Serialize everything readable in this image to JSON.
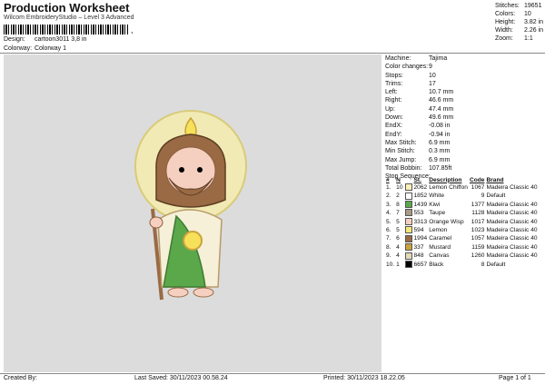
{
  "header": {
    "title": "Production Worksheet",
    "subtitle": "Wilcom EmbroideryStudio – Level 3 Advanced",
    "barcode_mark": ","
  },
  "design": {
    "design_label": "Design:",
    "design_value": "cartoon3011 3,8 in",
    "colorway_label": "Colorway:",
    "colorway_value": "Colorway 1"
  },
  "stats": [
    {
      "label": "Stitches:",
      "value": "19651"
    },
    {
      "label": "Colors:",
      "value": "10"
    },
    {
      "label": "Height:",
      "value": "3.82 in"
    },
    {
      "label": "Width:",
      "value": "2.26 in"
    },
    {
      "label": "Zoom:",
      "value": "1:1"
    }
  ],
  "machine": [
    {
      "label": "Machine:",
      "value": "Tajima"
    },
    {
      "label": "Color changes:",
      "value": "9"
    },
    {
      "label": "Stops:",
      "value": "10"
    },
    {
      "label": "Trims:",
      "value": "17"
    },
    {
      "label": "Left:",
      "value": "10.7 mm"
    },
    {
      "label": "Right:",
      "value": "46.6 mm"
    },
    {
      "label": "Up:",
      "value": "47.4 mm"
    },
    {
      "label": "Down:",
      "value": "49.6 mm"
    },
    {
      "label": "EndX:",
      "value": "-0.08 in"
    },
    {
      "label": "EndY:",
      "value": "-0.94 in"
    },
    {
      "label": "Max Stitch:",
      "value": "6.9 mm"
    },
    {
      "label": "Min Stitch:",
      "value": "0.3 mm"
    },
    {
      "label": "Max Jump:",
      "value": "6.9 mm"
    },
    {
      "label": "Total Bobbin:",
      "value": "107.85ft"
    }
  ],
  "sequence": {
    "title": "Stop Sequence:",
    "headers": [
      "#",
      "N",
      "St.",
      "Description",
      "Code",
      "Brand"
    ],
    "rows": [
      {
        "num": "1.",
        "n": "10",
        "color": "#fbf1b8",
        "st": "2062",
        "desc": "Lemon Chiffon",
        "code": "1067",
        "brand": "Madeira Classic 40"
      },
      {
        "num": "2.",
        "n": "2",
        "color": "#ffffff",
        "st": "1852",
        "desc": "White",
        "code": "9",
        "brand": "Default"
      },
      {
        "num": "3.",
        "n": "8",
        "color": "#5aa84a",
        "st": "1439",
        "desc": "Kiwi",
        "code": "1377",
        "brand": "Madeira Classic 40"
      },
      {
        "num": "4.",
        "n": "7",
        "color": "#a89a86",
        "st": "553",
        "desc": "Taupe",
        "code": "1128",
        "brand": "Madeira Classic 40"
      },
      {
        "num": "5.",
        "n": "5",
        "color": "#f5cfc0",
        "st": "3313",
        "desc": "Orange Wisp",
        "code": "1017",
        "brand": "Madeira Classic 40"
      },
      {
        "num": "6.",
        "n": "5",
        "color": "#f7e77a",
        "st": "594",
        "desc": "Lemon",
        "code": "1023",
        "brand": "Madeira Classic 40"
      },
      {
        "num": "7.",
        "n": "6",
        "color": "#9a6a44",
        "st": "1994",
        "desc": "Caramel",
        "code": "1057",
        "brand": "Madeira Classic 40"
      },
      {
        "num": "8.",
        "n": "4",
        "color": "#c9a23c",
        "st": "337",
        "desc": "Mustard",
        "code": "1159",
        "brand": "Madeira Classic 40"
      },
      {
        "num": "9.",
        "n": "4",
        "color": "#e3d9b8",
        "st": "848",
        "desc": "Canvas",
        "code": "1260",
        "brand": "Madeira Classic 40"
      },
      {
        "num": "10.",
        "n": "1",
        "color": "#000000",
        "st": "6657",
        "desc": "Black",
        "code": "8",
        "brand": "Default"
      }
    ]
  },
  "footer": {
    "created": "Created By:",
    "saved": "Last Saved: 30/11/2023 00.58.24",
    "printed": "Printed: 30/11/2023 18.22.05",
    "page": "Page 1 of 1"
  }
}
